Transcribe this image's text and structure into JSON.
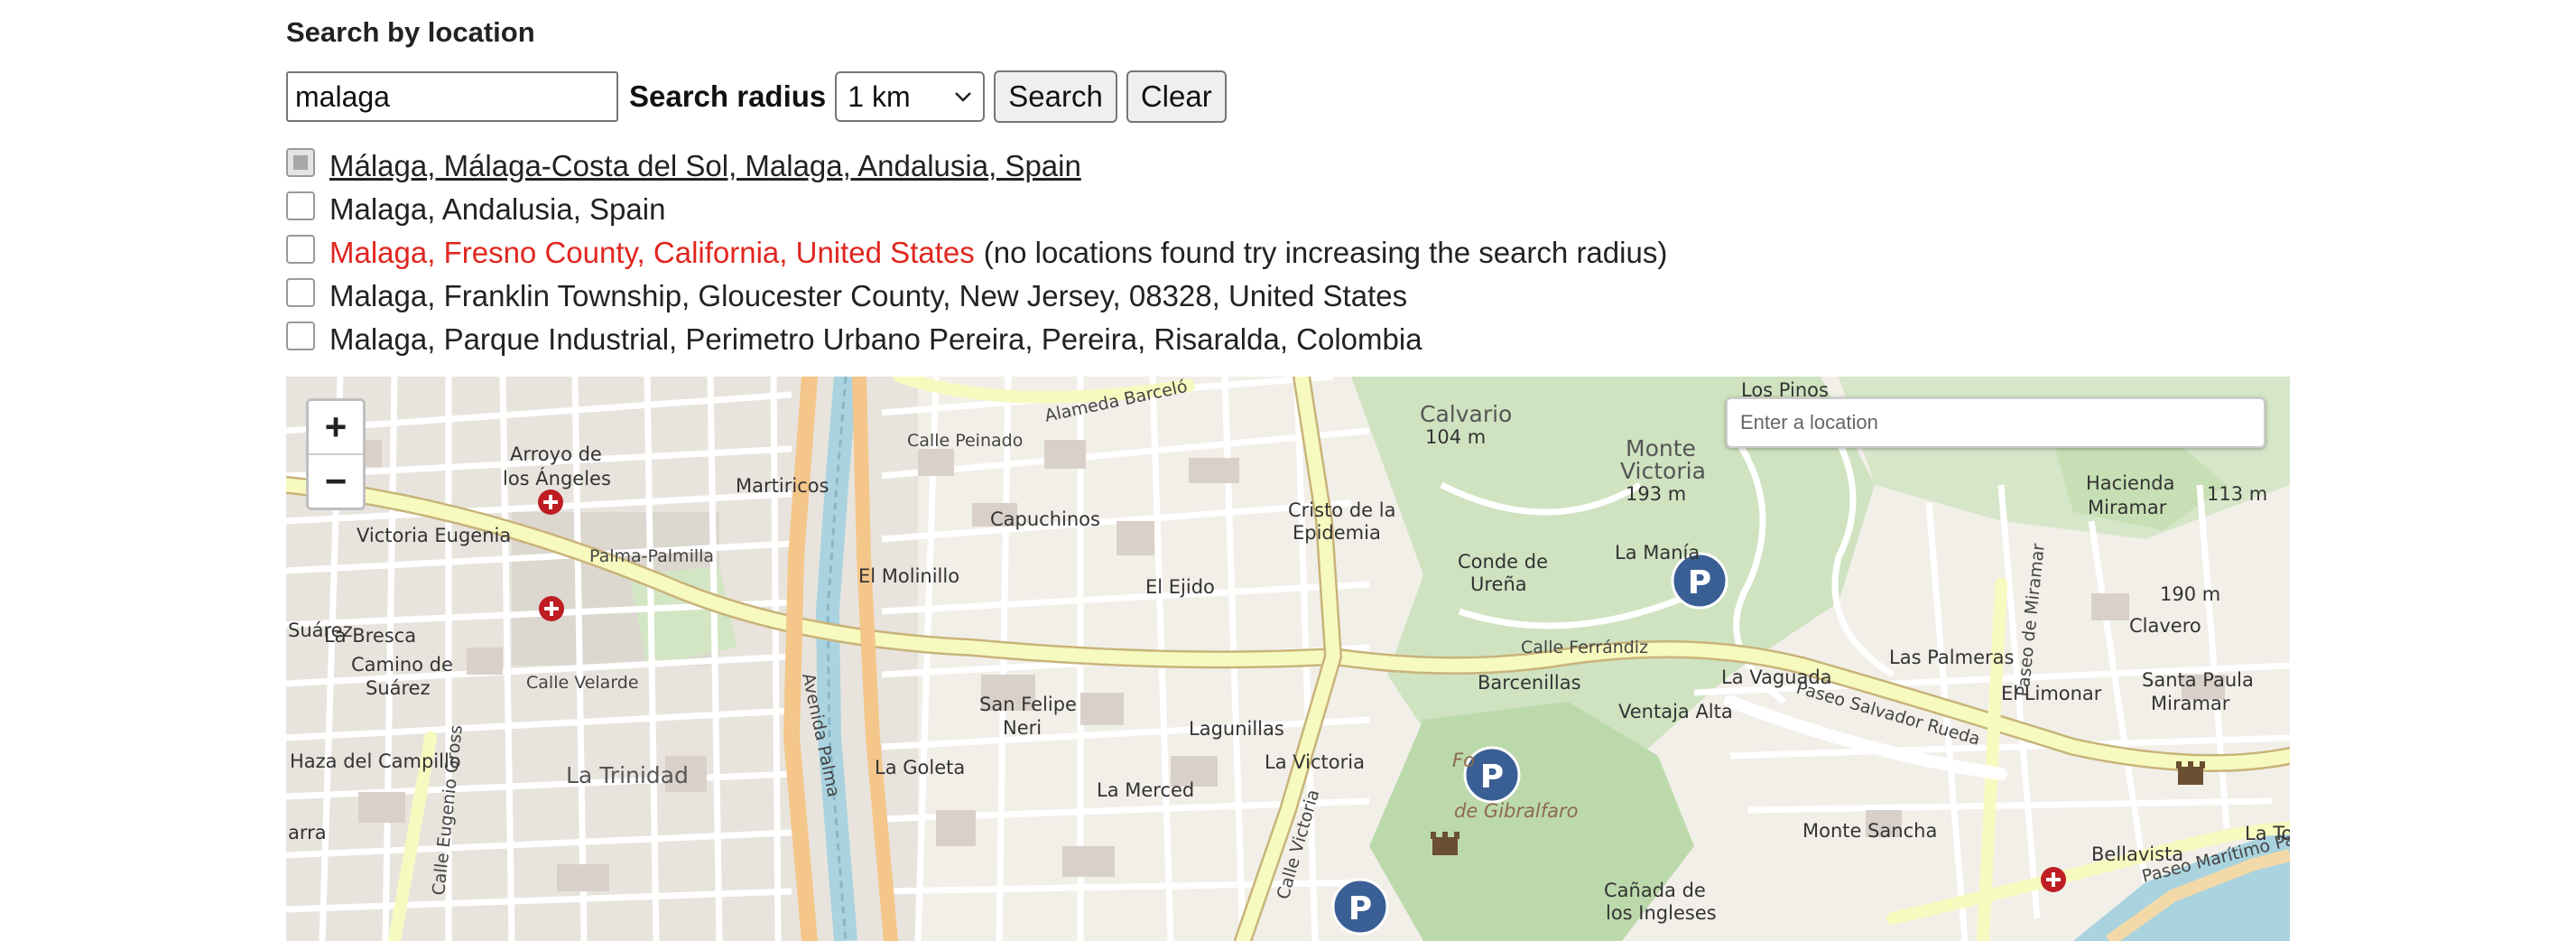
{
  "form": {
    "heading": "Search by location",
    "query_value": "malaga",
    "radius_label": "Search radius",
    "radius_selected": "1 km",
    "search_label": "Search",
    "clear_label": "Clear"
  },
  "results": [
    {
      "text": "Málaga, Málaga-Costa del Sol, Malaga, Andalusia, Spain",
      "checked": true,
      "style": "link",
      "note": ""
    },
    {
      "text": "Malaga, Andalusia, Spain",
      "checked": false,
      "style": "normal",
      "note": ""
    },
    {
      "text": "Malaga, Fresno County, California, United States",
      "checked": false,
      "style": "error",
      "note": "(no locations found try increasing the search radius)"
    },
    {
      "text": "Malaga, Franklin Township, Gloucester County, New Jersey, 08328, United States",
      "checked": false,
      "style": "normal",
      "note": ""
    },
    {
      "text": "Malaga, Parque Industrial, Perimetro Urbano Pereira, Pereira, Risaralda, Colombia",
      "checked": false,
      "style": "normal",
      "note": ""
    }
  ],
  "map": {
    "zoom_in": "+",
    "zoom_out": "−",
    "geocoder_placeholder": "Enter a location",
    "labels": {
      "arroyo": "Arroyo de",
      "los_angeles": "los Ángeles",
      "martiricos": "Martiricos",
      "victoria_eugenia": "Victoria Eugenia",
      "palma": "Palma-Palmilla",
      "capuchinos": "Capuchinos",
      "cristo": "Cristo de la",
      "epidemia": "Epidemia",
      "calvario": "Calvario",
      "calvario_h": "104 m",
      "monte_victoria": "Monte",
      "monte_victoria2": "Victoria",
      "monte_victoria_h": "193 m",
      "los_pinos": "Los Pinos",
      "hacienda": "Hacienda",
      "miramar": "Miramar",
      "h113": "113 m",
      "el_molinillo": "El Molinillo",
      "el_ejido": "El Ejido",
      "conde": "Conde de",
      "urena": "Ureña",
      "la_mania": "La Manía",
      "clavero": "Clavero",
      "h190": "190 m",
      "la_bresca": "La Bresca",
      "camino": "Camino de",
      "suarez": "Suárez",
      "calle_velarde": "Calle Velarde",
      "san_felipe": "San Felipe",
      "neri": "Neri",
      "lagunillas": "Lagunillas",
      "barcenillas": "Barcenillas",
      "ventaja_alta": "Ventaja Alta",
      "la_vaguada": "La Vaguada",
      "las_palmeras": "Las Palmeras",
      "el_limonar": "El Limonar",
      "santa_paula": "Santa Paula",
      "miramar2": "Miramar",
      "haza": "Haza del Campillo",
      "la_trinidad": "La Trinidad",
      "la_goleta": "La Goleta",
      "la_merced": "La Merced",
      "la_victoria": "La Victoria",
      "gibralfaro": "de Gibralfaro",
      "monte_sancha": "Monte Sancha",
      "canada": "Cañada de",
      "ingleses": "los Ingleses",
      "bellavista": "Bellavista",
      "calle_peinado": "Calle Peinado",
      "alameda_barcelo": "Alameda Barceló",
      "calle_ferrandiz": "Calle Ferrándiz",
      "avenida_palma": "Avenida Palma",
      "paseo_salvador": "Paseo Salvador Rueda",
      "paseo_miramar": "Paseo de Miramar",
      "paseo_maritimo": "Paseo Marítimo Pa",
      "calle_victoria": "Calle Victoria",
      "calle_eugenio": "Calle Eugenio Gross",
      "suarez_l": "Suárez",
      "arra": "arra",
      "la_to": "La To",
      "fo": "Fo"
    }
  }
}
